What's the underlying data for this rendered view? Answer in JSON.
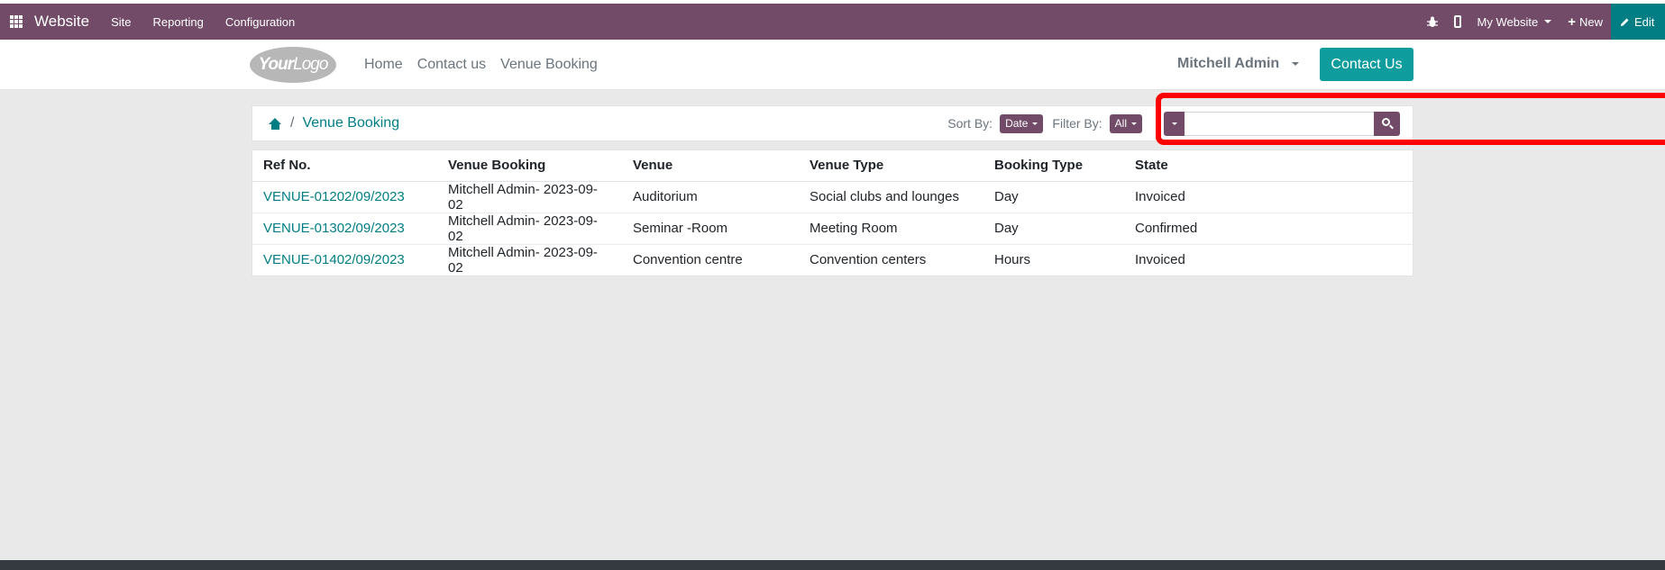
{
  "topbar": {
    "app_name": "Website",
    "menu": [
      "Site",
      "Reporting",
      "Configuration"
    ],
    "website_switcher": "My Website",
    "new_label": "New",
    "edit_label": "Edit",
    "bg_color": "#714b67",
    "edit_bg_color": "#017e84"
  },
  "header": {
    "logo_text_1": "Your",
    "logo_text_2": "Logo",
    "nav": [
      "Home",
      "Contact us",
      "Venue Booking"
    ],
    "user": "Mitchell Admin",
    "contact_button": "Contact Us"
  },
  "breadcrumb": {
    "separator": "/",
    "current": "Venue Booking"
  },
  "controls": {
    "sort_label": "Sort By:",
    "sort_value": "Date",
    "filter_label": "Filter By:",
    "filter_value": "All",
    "search_value": "",
    "search_placeholder": ""
  },
  "table": {
    "columns": [
      "Ref No.",
      "Venue Booking",
      "Venue",
      "Venue Type",
      "Booking Type",
      "State"
    ],
    "rows": [
      [
        "VENUE-01202/09/2023",
        "Mitchell Admin- 2023-09-02",
        "Auditorium",
        "Social clubs and lounges",
        "Day",
        "Invoiced"
      ],
      [
        "VENUE-01302/09/2023",
        "Mitchell Admin- 2023-09-02",
        "Seminar -Room",
        "Meeting Room",
        "Day",
        "Confirmed"
      ],
      [
        "VENUE-01402/09/2023",
        "Mitchell Admin- 2023-09-02",
        "Convention centre",
        "Convention centers",
        "Hours",
        "Invoiced"
      ]
    ]
  },
  "colors": {
    "accent": "#017e84",
    "contact_button": "#0e9c9c",
    "highlight": "#ff0000"
  }
}
